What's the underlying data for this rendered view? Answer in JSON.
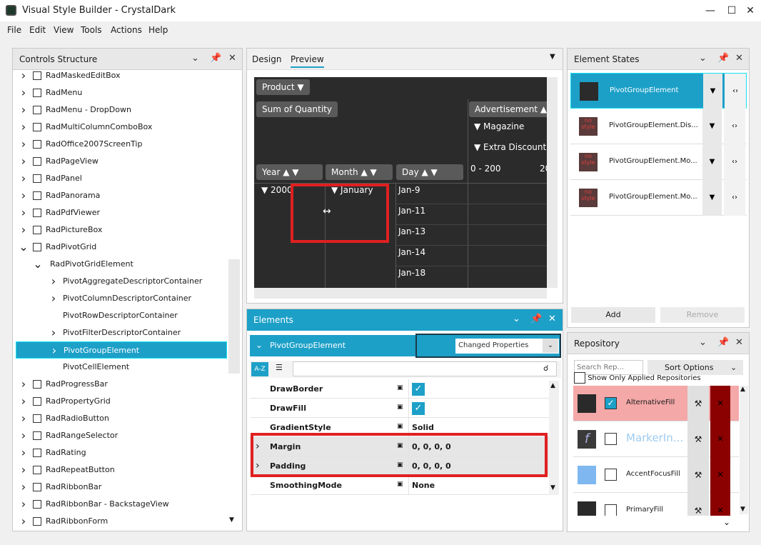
{
  "window": {
    "title": "Visual Style Builder - CrystalDark"
  },
  "menu": [
    "File",
    "Edit",
    "View",
    "Tools",
    "Actions",
    "Help"
  ],
  "controls_structure": {
    "title": "Controls Structure",
    "items": [
      {
        "label": "RadMaskedEditBox",
        "level": 0,
        "expand": true
      },
      {
        "label": "RadMenu",
        "level": 0,
        "expand": true
      },
      {
        "label": "RadMenu - DropDown",
        "level": 0,
        "expand": true
      },
      {
        "label": "RadMultiColumnComboBox",
        "level": 0,
        "expand": true
      },
      {
        "label": "RadOffice2007ScreenTip",
        "level": 0,
        "expand": true
      },
      {
        "label": "RadPageView",
        "level": 0,
        "expand": true
      },
      {
        "label": "RadPanel",
        "level": 0,
        "expand": true
      },
      {
        "label": "RadPanorama",
        "level": 0,
        "expand": true
      },
      {
        "label": "RadPdfViewer",
        "level": 0,
        "expand": true
      },
      {
        "label": "RadPictureBox",
        "level": 0,
        "expand": true
      },
      {
        "label": "RadPivotGrid",
        "level": 0,
        "expand": "open"
      },
      {
        "label": "RadPivotGridElement",
        "level": 1,
        "expand": "open"
      },
      {
        "label": "PivotAggregateDescriptorContainer",
        "level": 2,
        "expand": true
      },
      {
        "label": "PivotColumnDescriptorContainer",
        "level": 2,
        "expand": true
      },
      {
        "label": "PivotRowDescriptorContainer",
        "level": 2,
        "expand": false
      },
      {
        "label": "PivotFilterDescriptorContainer",
        "level": 2,
        "expand": true
      },
      {
        "label": "PivotGroupElement",
        "level": 2,
        "expand": true,
        "selected": true
      },
      {
        "label": "PivotCellElement",
        "level": 2,
        "expand": false
      },
      {
        "label": "RadProgressBar",
        "level": 0,
        "expand": true
      },
      {
        "label": "RadPropertyGrid",
        "level": 0,
        "expand": true
      },
      {
        "label": "RadRadioButton",
        "level": 0,
        "expand": true
      },
      {
        "label": "RadRangeSelector",
        "level": 0,
        "expand": true
      },
      {
        "label": "RadRating",
        "level": 0,
        "expand": true
      },
      {
        "label": "RadRepeatButton",
        "level": 0,
        "expand": true
      },
      {
        "label": "RadRibbonBar",
        "level": 0,
        "expand": true
      },
      {
        "label": "RadRibbonBar - BackstageView",
        "level": 0,
        "expand": true
      },
      {
        "label": "RadRibbonForm",
        "level": 0,
        "expand": true
      }
    ]
  },
  "preview": {
    "tabs": [
      "Design",
      "Preview"
    ],
    "filter_button": "Product",
    "aggregate_button": "Sum of Quantity",
    "column_header": "Advertisement",
    "column_sub1": "Magazine",
    "column_sub2": "Extra Discount",
    "column_range": "0 - 200",
    "column_range2": "20",
    "row_headers": [
      "Year",
      "Month",
      "Day"
    ],
    "year": "2000",
    "month": "January",
    "days": [
      "Jan-9",
      "Jan-11",
      "Jan-13",
      "Jan-14",
      "Jan-18"
    ]
  },
  "elements": {
    "title": "Elements",
    "group": "PivotGroupElement",
    "filter": "Changed Properties",
    "sort_button": "A-Z",
    "properties": [
      {
        "name": "DrawBorder",
        "value": "",
        "check": true
      },
      {
        "name": "DrawFill",
        "value": "",
        "check": true
      },
      {
        "name": "GradientStyle",
        "value": "Solid",
        "check": false
      },
      {
        "name": "Margin",
        "value": "0, 0, 0, 0",
        "check": false,
        "expand": true
      },
      {
        "name": "Padding",
        "value": "0, 0, 0, 0",
        "check": false,
        "expand": true
      },
      {
        "name": "SmoothingMode",
        "value": "None",
        "check": false
      }
    ]
  },
  "element_states": {
    "title": "Element States",
    "items": [
      {
        "name": "PivotGroupElement",
        "selected": true
      },
      {
        "name": "PivotGroupElement.Dis...",
        "selected": false
      },
      {
        "name": "PivotGroupElement.Mo...",
        "selected": false
      },
      {
        "name": "PivotGroupElement.Mo...",
        "selected": false
      }
    ],
    "no_style": "no style",
    "add_label": "Add",
    "remove_label": "Remove"
  },
  "repository": {
    "title": "Repository",
    "search_placeholder": "Search Rep...",
    "sort_options": "Sort Options",
    "show_applied": "Show Only Applied Repositories",
    "items": [
      {
        "name": "AlternativeFill",
        "checked": true,
        "color": "#2a2a2a",
        "glyph": ""
      },
      {
        "name": "MarkerIn...",
        "checked": false,
        "color": "#3a3a3a",
        "glyph": "f"
      },
      {
        "name": "AccentFocusFill",
        "checked": false,
        "color": "#7fb8f0",
        "glyph": ""
      },
      {
        "name": "PrimaryFill",
        "checked": false,
        "color": "#2a2a2a",
        "glyph": ""
      }
    ]
  }
}
